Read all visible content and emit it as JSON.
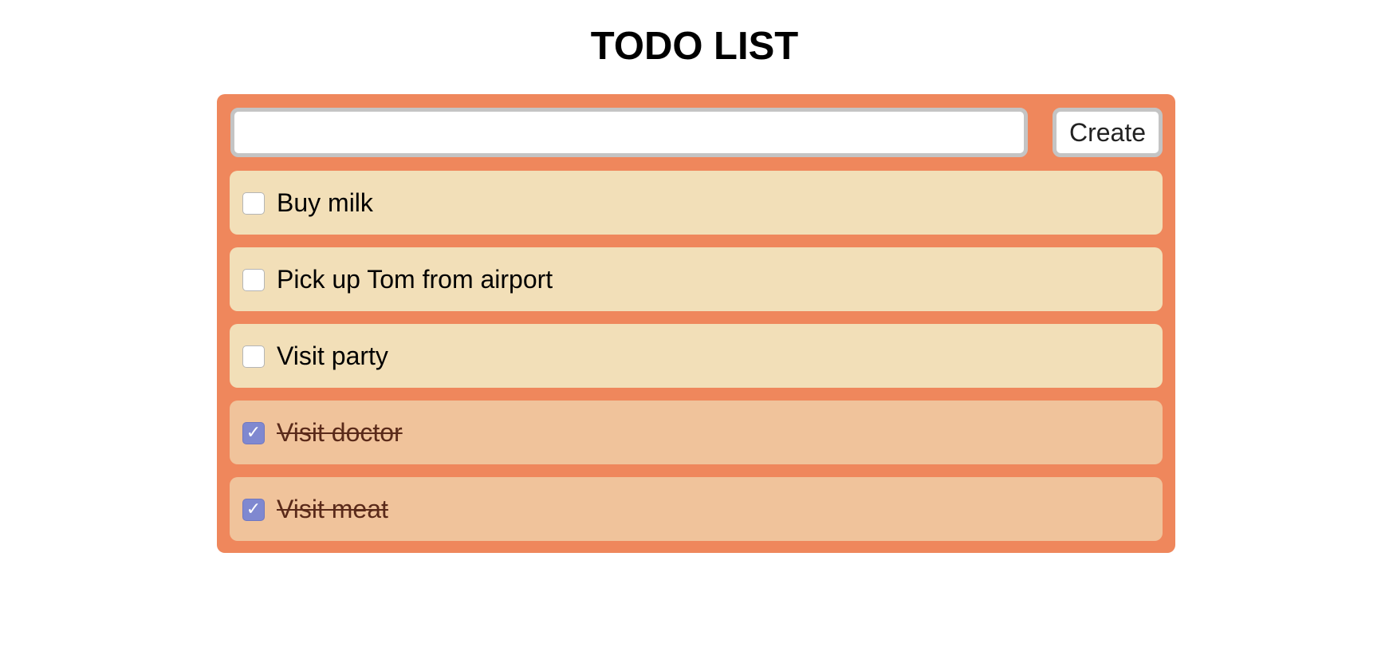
{
  "page": {
    "title": "TODO LIST"
  },
  "composer": {
    "input_value": "",
    "input_placeholder": "",
    "create_label": "Create"
  },
  "todos": [
    {
      "label": "Buy milk",
      "done": false
    },
    {
      "label": "Pick up Tom from airport",
      "done": false
    },
    {
      "label": "Visit party",
      "done": false
    },
    {
      "label": "Visit doctor",
      "done": true
    },
    {
      "label": "Visit meat",
      "done": true
    }
  ],
  "icons": {
    "checkbox_checked": "check-icon"
  },
  "colors": {
    "panel": "#ef875c",
    "item_open": "#f2dfb8",
    "item_done": "#f0c39b",
    "checkbox_checked": "#7f88d0",
    "input_border": "#c4c4c4"
  }
}
